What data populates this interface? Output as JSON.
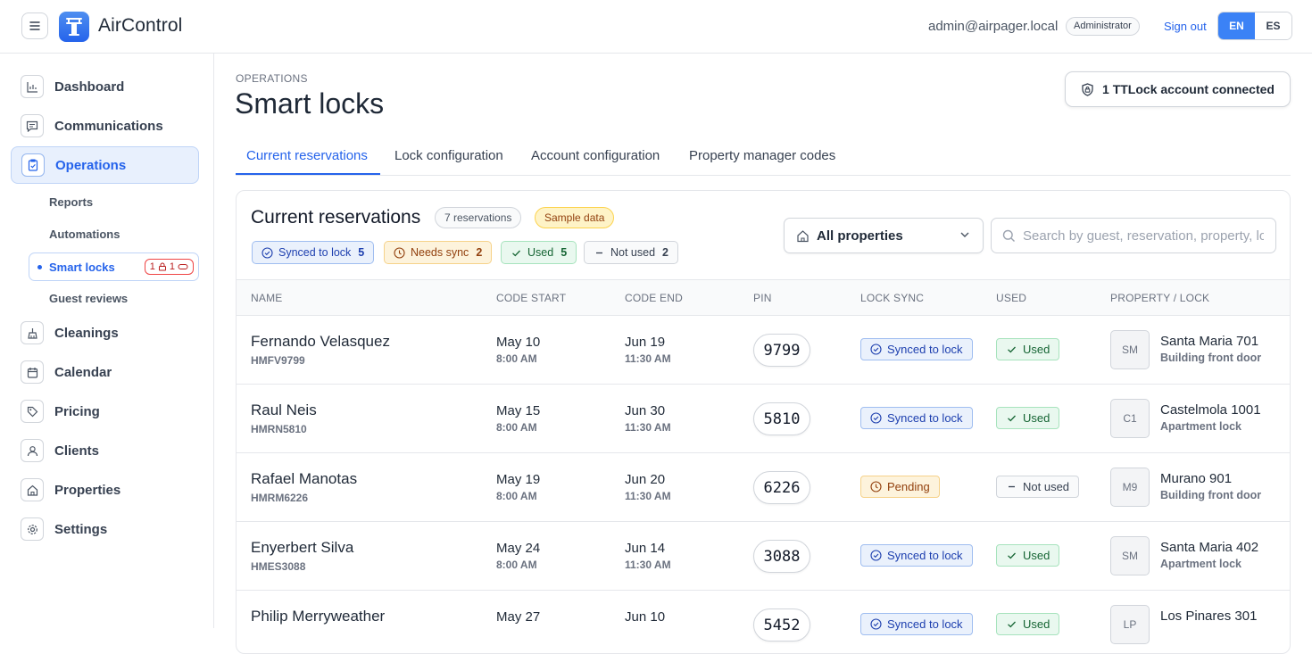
{
  "header": {
    "brand": "AirControl",
    "user_email": "admin@airpager.local",
    "role": "Administrator",
    "sign_out": "Sign out",
    "languages": [
      "EN",
      "ES"
    ],
    "active_language": "EN",
    "accent_color": "#3b82f6"
  },
  "sidebar": {
    "items": [
      {
        "label": "Dashboard",
        "icon": "bar-chart-icon"
      },
      {
        "label": "Communications",
        "icon": "message-icon"
      },
      {
        "label": "Operations",
        "icon": "clipboard-icon"
      },
      {
        "label": "Cleanings",
        "icon": "broom-icon"
      },
      {
        "label": "Calendar",
        "icon": "calendar-icon"
      },
      {
        "label": "Pricing",
        "icon": "tag-icon"
      },
      {
        "label": "Clients",
        "icon": "user-icon"
      },
      {
        "label": "Properties",
        "icon": "house-icon"
      },
      {
        "label": "Settings",
        "icon": "gear-icon"
      }
    ],
    "subitems": [
      "Reports",
      "Automations",
      "Smart locks",
      "Guest reviews"
    ],
    "smart_locks_counts": {
      "locked": "1",
      "keys": "1"
    }
  },
  "page": {
    "eyebrow": "OPERATIONS",
    "title": "Smart locks",
    "ttlock_button": "1 TTLock account connected",
    "tabs": [
      "Current reservations",
      "Lock configuration",
      "Account configuration",
      "Property manager codes"
    ]
  },
  "reservations": {
    "title": "Current reservations",
    "count_pill": "7 reservations",
    "sample_pill": "Sample data",
    "filters": [
      {
        "label": "Synced to lock",
        "count": "5"
      },
      {
        "label": "Needs sync",
        "count": "2"
      },
      {
        "label": "Used",
        "count": "5"
      },
      {
        "label": "Not used",
        "count": "2"
      }
    ],
    "property_select": "All properties",
    "search_placeholder": "Search by guest, reservation, property, lock",
    "columns": [
      "NAME",
      "CODE START",
      "CODE END",
      "PIN",
      "LOCK SYNC",
      "USED",
      "PROPERTY / LOCK"
    ],
    "rows": [
      {
        "name": "Fernando Velasquez",
        "code": "HMFV9799",
        "start_date": "May 10",
        "start_time": "8:00 AM",
        "end_date": "Jun 19",
        "end_time": "11:30 AM",
        "pin": "9799",
        "sync": "Synced to lock",
        "sync_state": "synced",
        "used": "Used",
        "used_state": "used",
        "abbr": "SM",
        "property": "Santa Maria 701",
        "lock": "Building front door"
      },
      {
        "name": "Raul Neis",
        "code": "HMRN5810",
        "start_date": "May 15",
        "start_time": "8:00 AM",
        "end_date": "Jun 30",
        "end_time": "11:30 AM",
        "pin": "5810",
        "sync": "Synced to lock",
        "sync_state": "synced",
        "used": "Used",
        "used_state": "used",
        "abbr": "C1",
        "property": "Castelmola 1001",
        "lock": "Apartment lock"
      },
      {
        "name": "Rafael Manotas",
        "code": "HMRM6226",
        "start_date": "May 19",
        "start_time": "8:00 AM",
        "end_date": "Jun 20",
        "end_time": "11:30 AM",
        "pin": "6226",
        "sync": "Pending",
        "sync_state": "pending",
        "used": "Not used",
        "used_state": "notused",
        "abbr": "M9",
        "property": "Murano 901",
        "lock": "Building front door"
      },
      {
        "name": "Enyerbert Silva",
        "code": "HMES3088",
        "start_date": "May 24",
        "start_time": "8:00 AM",
        "end_date": "Jun 14",
        "end_time": "11:30 AM",
        "pin": "3088",
        "sync": "Synced to lock",
        "sync_state": "synced",
        "used": "Used",
        "used_state": "used",
        "abbr": "SM",
        "property": "Santa Maria 402",
        "lock": "Apartment lock"
      },
      {
        "name": "Philip Merryweather",
        "code": "",
        "start_date": "May 27",
        "start_time": "",
        "end_date": "Jun 10",
        "end_time": "",
        "pin": "5452",
        "sync": "Synced to lock",
        "sync_state": "synced",
        "used": "Used",
        "used_state": "used",
        "abbr": "LP",
        "property": "Los Pinares 301",
        "lock": ""
      }
    ]
  }
}
